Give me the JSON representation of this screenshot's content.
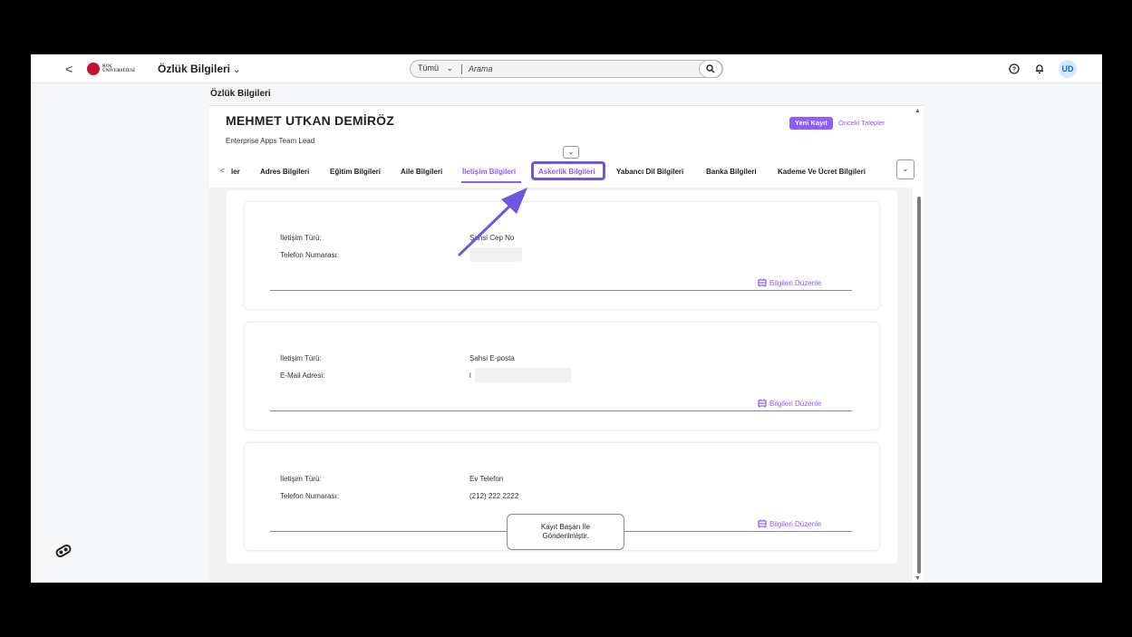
{
  "shell": {
    "back_symbol": "<",
    "logo_text_line1": "KOÇ",
    "logo_text_line2": "ÜNİVERSİTESİ",
    "app_title": "Özlük Bilgileri",
    "search_scope": "Tümü",
    "search_placeholder": "Arama",
    "avatar_initials": "UD",
    "icons": [
      "help-icon",
      "bell-icon"
    ]
  },
  "page_title": "Özlük Bilgileri",
  "employee": {
    "name": "MEHMET UTKAN DEMİRÖZ",
    "role": "Enterprise Apps Team Lead"
  },
  "actions": {
    "new_record": "Yeni Kayıt",
    "previous_requests": "Önceki Talepler"
  },
  "tabs": [
    {
      "label": "ler"
    },
    {
      "label": "Adres Bilgileri"
    },
    {
      "label": "Eğitim Bilgileri"
    },
    {
      "label": "Aile Bilgileri"
    },
    {
      "label": "İletişim Bilgileri",
      "active": true
    },
    {
      "label": "Askerlik Bilgileri",
      "highlighted": true
    },
    {
      "label": "Yabancı Dil Bilgileri"
    },
    {
      "label": "Banka Bilgileri"
    },
    {
      "label": "Kademe Ve Ücret Bilgileri"
    }
  ],
  "cards": [
    {
      "label1": "İletişim Türü:",
      "value1": "Şahsi Cep No",
      "label2": "Telefon Numarası:",
      "value2": "",
      "edit": "Bilgileri Düzenle"
    },
    {
      "label1": "İletişim Türü:",
      "value1": "Şahsi E-posta",
      "label2": "E-Mail Adresi:",
      "value2": "l",
      "edit": "Bilgileri Düzenle"
    },
    {
      "label1": "İletişim Türü:",
      "value1": "Ev Telefon",
      "label2": "Telefon Numarası:",
      "value2": "(212) 222 2222",
      "edit": "Bilgileri Düzenle"
    }
  ],
  "toast": {
    "line1": "Kayıt Başarı İle",
    "line2": "Gönderilmiştir."
  },
  "colors": {
    "accent": "#8f5cff",
    "highlight_border": "#6e57e0"
  }
}
